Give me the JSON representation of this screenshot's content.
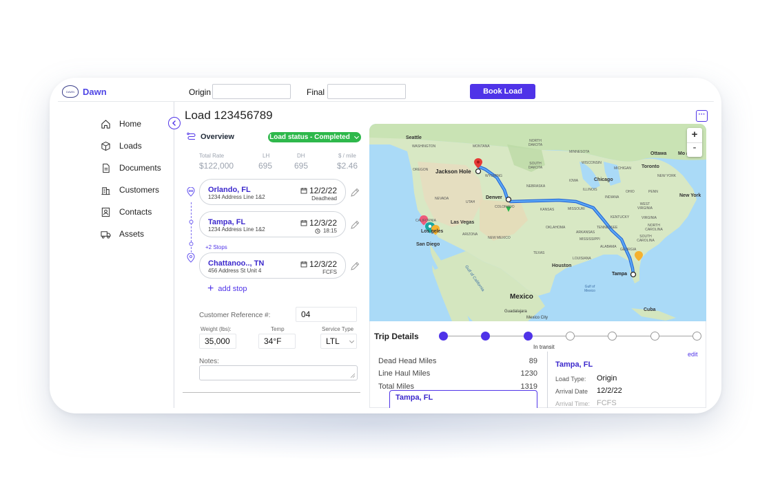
{
  "header": {
    "brand": "Dawn",
    "logo_text": "DAWN",
    "origin_label": "Origin",
    "origin_value": "",
    "final_label": "Final",
    "final_value": "",
    "book_button": "Book Load"
  },
  "sidebar": {
    "items": [
      {
        "label": "Home",
        "icon": "home-icon"
      },
      {
        "label": "Loads",
        "icon": "box-icon"
      },
      {
        "label": "Documents",
        "icon": "document-icon"
      },
      {
        "label": "Customers",
        "icon": "building-icon"
      },
      {
        "label": "Contacts",
        "icon": "contact-card-icon"
      },
      {
        "label": "Assets",
        "icon": "truck-icon"
      }
    ]
  },
  "load": {
    "title": "Load 123456789",
    "overview_label": "Overview",
    "status": "Load status - Completed",
    "stats": [
      {
        "label": "Total Rate",
        "value": "$122,000"
      },
      {
        "label": "LH",
        "value": "695"
      },
      {
        "label": "DH",
        "value": "695"
      },
      {
        "label": "$ / mile",
        "value": "$2.46"
      }
    ],
    "stops": [
      {
        "city": "Orlando, FL",
        "address": "1234 Address Line 1&2",
        "date": "12/2/22",
        "sub": "Deadhead"
      },
      {
        "city": "Tampa, FL",
        "address": "1234 Address Line 1&2",
        "date": "12/3/22",
        "sub": "18:15"
      },
      {
        "city": "Chattanoo.., TN",
        "address": "456 Address St Unit 4",
        "date": "12/3/22",
        "sub": "FCFS"
      }
    ],
    "more_stops": "+2 Stops",
    "add_stop": "add stop",
    "customer_ref_label": "Customer Reference #:",
    "customer_ref_value": "04",
    "weight_label": "Weight (lbs):",
    "weight_value": "35,000",
    "temp_label": "Temp",
    "temp_value": "34°F",
    "service_label": "Service Type",
    "service_value": "LTL",
    "notes_label": "Notes:"
  },
  "map": {
    "labels": {
      "seattle": "Seattle",
      "washington": "WASHINGTON",
      "montana": "MONTANA",
      "north_dakota": "NORTH DAKOTA",
      "minnesota": "MINNESOTA",
      "ottawa": "Ottawa",
      "montreal": "Mo  al",
      "oregon": "OREGON",
      "jackson_hole": "Jackson Hole",
      "wyoming": "WYOMING",
      "south_dakota": "SOUTH DAKOTA",
      "wisconsin": "WISCONSIN",
      "michigan": "MICHIGAN",
      "toronto": "Toronto",
      "new_york_state": "NEW YORK",
      "nebraska": "NEBRASKA",
      "chicago": "Chicago",
      "iowa": "IOWA",
      "nevada": "NEVADA",
      "utah": "UTAH",
      "denver": "Denver",
      "illinois": "ILLINOIS",
      "indiana": "INDIANA",
      "ohio": "OHIO",
      "penn": "PENN",
      "new_york": "New York",
      "colorado": "COLORADO",
      "kansas": "KANSAS",
      "missouri": "MISSOURI",
      "west_virginia": "WEST VIRGINIA",
      "california": "CALIFORNIA",
      "las_vegas": "Las Vegas",
      "kentucky": "KENTUCKY",
      "virginia": "VIRGINIA",
      "los_angeles": "Los   geles",
      "arizona": "ARIZONA",
      "oklahoma": "OKLAHOMA",
      "tennessee": "TENNESSEE",
      "north_carolina": "NORTH CAROLINA",
      "san_diego": "San Diego",
      "new_mexico": "NEW MEXICO",
      "arkansas": "ARKANSAS",
      "mississippi": "MISSISSIPPI",
      "south_carolina": "SOUTH CAROLINA",
      "alabama": "ALABAMA",
      "georgia": "GEORGIA",
      "texas": "TEXAS",
      "louisiana": "LOUISIANA",
      "houston": "Houston",
      "gulf_of_california": "Gulf of California",
      "tampa": "Tampa",
      "gulf_of_mexico": "Gulf of Mexico",
      "mexico": "Mexico",
      "cuba": "Cuba",
      "guadalajara": "Guadalajara",
      "mexico_city": "Mexico City"
    },
    "zoom_in": "+",
    "zoom_out": "-"
  },
  "trip": {
    "title": "Trip Details",
    "in_transit": "In transit",
    "progress_steps_done": 3,
    "progress_steps_total": 7,
    "miles": [
      {
        "label": "Dead Head Miles",
        "value": "89"
      },
      {
        "label": "Line Haul Miles",
        "value": "1230"
      },
      {
        "label": "Total Miles",
        "value": "1319"
      }
    ],
    "edit": "edit",
    "detail_city": "Tampa, FL",
    "load_type_label": "Load Type:",
    "load_type_value": "Origin",
    "arrival_date_label": "Arrival Date",
    "arrival_date_value": "12/2/22",
    "arrival_time_label": "Arrival Time:",
    "arrival_time_value": "FCFS",
    "selected_stop": "Tampa, FL"
  },
  "colors": {
    "accent": "#4f33e8",
    "status_green": "#2eb84b",
    "route_blue": "#3d8be8"
  }
}
